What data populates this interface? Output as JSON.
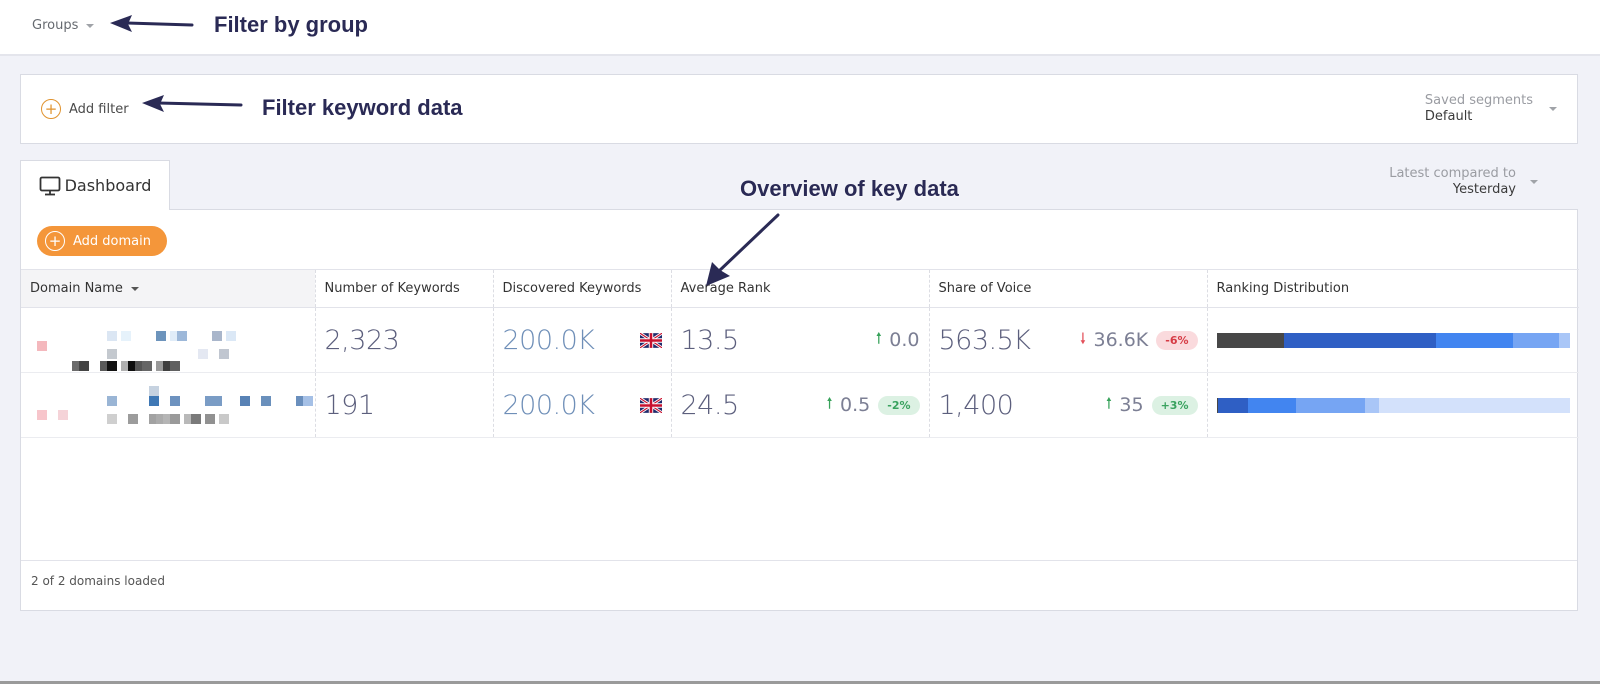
{
  "topbar": {
    "groups_label": "Groups"
  },
  "annotations": {
    "filter_by_group": "Filter by group",
    "filter_keyword_data": "Filter keyword data",
    "overview_key_data": "Overview of key data"
  },
  "filters": {
    "add_filter_label": "Add filter",
    "saved_segments_label": "Saved segments",
    "saved_segments_value": "Default"
  },
  "comparison": {
    "label": "Latest compared to",
    "value": "Yesterday"
  },
  "tabs": [
    {
      "label": "Dashboard",
      "icon": "monitor-icon",
      "active": true
    }
  ],
  "actions": {
    "add_domain_label": "Add domain"
  },
  "table": {
    "columns": [
      "Domain Name",
      "Number of Keywords",
      "Discovered Keywords",
      "Average Rank",
      "Share of Voice",
      "Ranking Distribution"
    ],
    "sorted_column": "Domain Name",
    "rows": [
      {
        "domain": "(redacted)",
        "keywords": "2,323",
        "discovered": "200.0K",
        "country_flag": "uk-flag",
        "avg_rank": "13.5",
        "avg_rank_change": "0.0",
        "avg_rank_direction": "up",
        "avg_rank_pct": "",
        "sov": "563.5K",
        "sov_change": "36.6K",
        "sov_direction": "down",
        "sov_pct": "-6%",
        "distribution": [
          {
            "share": 0.19,
            "color": "#474747"
          },
          {
            "share": 0.43,
            "color": "#2f5fc4"
          },
          {
            "share": 0.22,
            "color": "#4285f0"
          },
          {
            "share": 0.13,
            "color": "#76a5f3"
          },
          {
            "share": 0.03,
            "color": "#a9c6f7"
          }
        ]
      },
      {
        "domain": "(redacted)",
        "keywords": "191",
        "discovered": "200.0K",
        "country_flag": "uk-flag",
        "avg_rank": "24.5",
        "avg_rank_change": "0.5",
        "avg_rank_direction": "up",
        "avg_rank_pct": "-2%",
        "sov": "1,400",
        "sov_change": "35",
        "sov_direction": "up",
        "sov_pct": "+3%",
        "distribution": [
          {
            "share": 0.005,
            "color": "#474747"
          },
          {
            "share": 0.085,
            "color": "#2f5fc4"
          },
          {
            "share": 0.135,
            "color": "#4285f0"
          },
          {
            "share": 0.195,
            "color": "#76a5f3"
          },
          {
            "share": 0.04,
            "color": "#a9c6f7"
          },
          {
            "share": 0.54,
            "color": "#d3e1fb"
          }
        ]
      }
    ]
  },
  "footer": {
    "status": "2 of 2 domains loaded"
  },
  "colors": {
    "accent_orange": "#f4963a",
    "up_green": "#37a25a",
    "down_red": "#e3505a",
    "annotation_navy": "#2a2a55"
  }
}
